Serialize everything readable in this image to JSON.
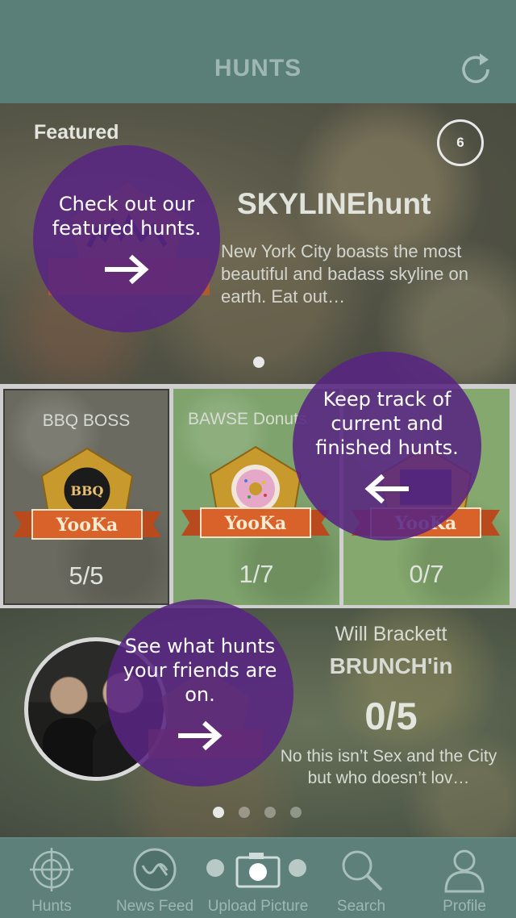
{
  "header": {
    "title": "HUNTS",
    "refresh_icon": "refresh-icon"
  },
  "featured": {
    "label": "Featured",
    "count": "6",
    "title": "SKYLINEhunt",
    "description": "New York City boasts the most beautiful and badass skyline on earth. Eat out…",
    "badge_text": "YooKa"
  },
  "hunts": [
    {
      "title": "BBQ BOSS",
      "progress": "5/5",
      "badge_text": "YooKa",
      "emblem": "BBQ"
    },
    {
      "title": "BAWSE Donuts",
      "progress": "1/7",
      "badge_text": "YooKa"
    },
    {
      "title": "",
      "progress": "0/7",
      "badge_text": "YooKa"
    }
  ],
  "friend": {
    "name": "Will Brackett",
    "hunt": "BRUNCH'in",
    "score": "0/5",
    "description": "No this isn’t Sex and the City but who doesn’t lov…",
    "badge_text": "YooKa"
  },
  "tooltips": {
    "featured": "Check out our featured hunts.",
    "track": "Keep track of current and finished hunts.",
    "friends": "See what hunts your friends are on."
  },
  "tabs": [
    {
      "label": "Hunts",
      "icon": "crosshair-icon"
    },
    {
      "label": "News Feed",
      "icon": "yooka-logo-icon"
    },
    {
      "label": "Upload Picture",
      "icon": "camera-icon"
    },
    {
      "label": "Search",
      "icon": "search-icon"
    },
    {
      "label": "Profile",
      "icon": "person-icon"
    }
  ],
  "colors": {
    "header_bg": "#5a7f79",
    "tooltip_purple": "#582482",
    "ribbon_orange": "#d9622b",
    "badge_gold": "#c89a2e"
  }
}
